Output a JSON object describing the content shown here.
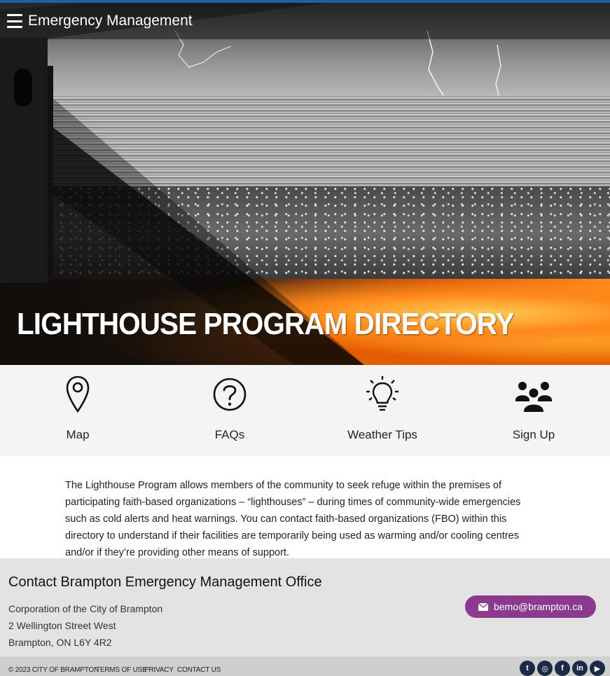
{
  "header": {
    "site_title": "Emergency Management"
  },
  "hero": {
    "heading": "LIGHTHOUSE PROGRAM DIRECTORY"
  },
  "nav_tiles": [
    {
      "label": "Map",
      "icon": "map-pin-icon"
    },
    {
      "label": "FAQs",
      "icon": "question-circle-icon"
    },
    {
      "label": "Weather Tips",
      "icon": "lightbulb-icon"
    },
    {
      "label": "Sign Up",
      "icon": "group-people-icon"
    }
  ],
  "intro": {
    "text": "The Lighthouse Program allows members of the community to seek refuge within the premises of participating faith-based organizations – “lighthouses” – during times of community-wide emergencies such as cold alerts and heat warnings. You can contact faith-based organizations (FBO) within this directory to understand if their facilities are temporarily being used as warming and/or cooling centres and/or if they’re providing other means of support."
  },
  "footer": {
    "title": "Contact Brampton Emergency Management Office",
    "address": [
      "Corporation of the City of Brampton",
      "2 Wellington Street West",
      "Brampton, ON L6Y 4R2"
    ],
    "email_label": "bemo@brampton.ca",
    "accent_color": "#8b3a8d"
  },
  "bottom_bar": {
    "copyright": "© 2023 CITY OF BRAMPTON",
    "links": [
      "TERMS OF USE",
      "PRIVACY",
      "CONTACT US"
    ],
    "social": [
      {
        "name": "twitter-icon",
        "glyph": "t"
      },
      {
        "name": "instagram-icon",
        "glyph": "◎"
      },
      {
        "name": "facebook-icon",
        "glyph": "f"
      },
      {
        "name": "linkedin-icon",
        "glyph": "in"
      },
      {
        "name": "youtube-icon",
        "glyph": "▶"
      }
    ]
  }
}
